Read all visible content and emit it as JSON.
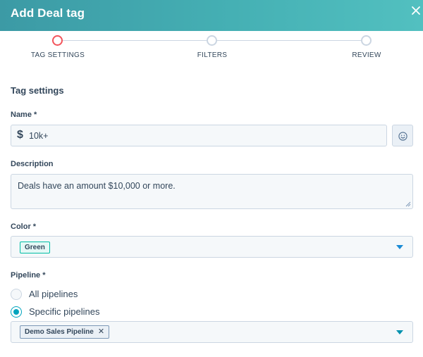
{
  "header": {
    "title": "Add Deal tag",
    "close_icon": "close-icon"
  },
  "stepper": {
    "steps": [
      {
        "label": "TAG SETTINGS",
        "state": "active"
      },
      {
        "label": "FILTERS",
        "state": "inactive"
      },
      {
        "label": "REVIEW",
        "state": "inactive"
      }
    ]
  },
  "form": {
    "section_title": "Tag settings",
    "name": {
      "label": "Name *",
      "value": "10k+",
      "icon": "dollar-icon"
    },
    "emoji_icon": "smiley-icon",
    "description": {
      "label": "Description",
      "value": "Deals have an amount $10,000 or more."
    },
    "color": {
      "label": "Color *",
      "selected": "Green",
      "chip_color": "#00bda5"
    },
    "pipeline": {
      "label": "Pipeline *",
      "options": [
        {
          "label": "All pipelines",
          "checked": false
        },
        {
          "label": "Specific pipelines",
          "checked": true
        }
      ],
      "selected_chip": "Demo Sales Pipeline"
    }
  },
  "colors": {
    "header_start": "#3c9aa5",
    "header_end": "#52c0c0",
    "active_step": "#f2545b",
    "accent": "#00a4bd"
  }
}
